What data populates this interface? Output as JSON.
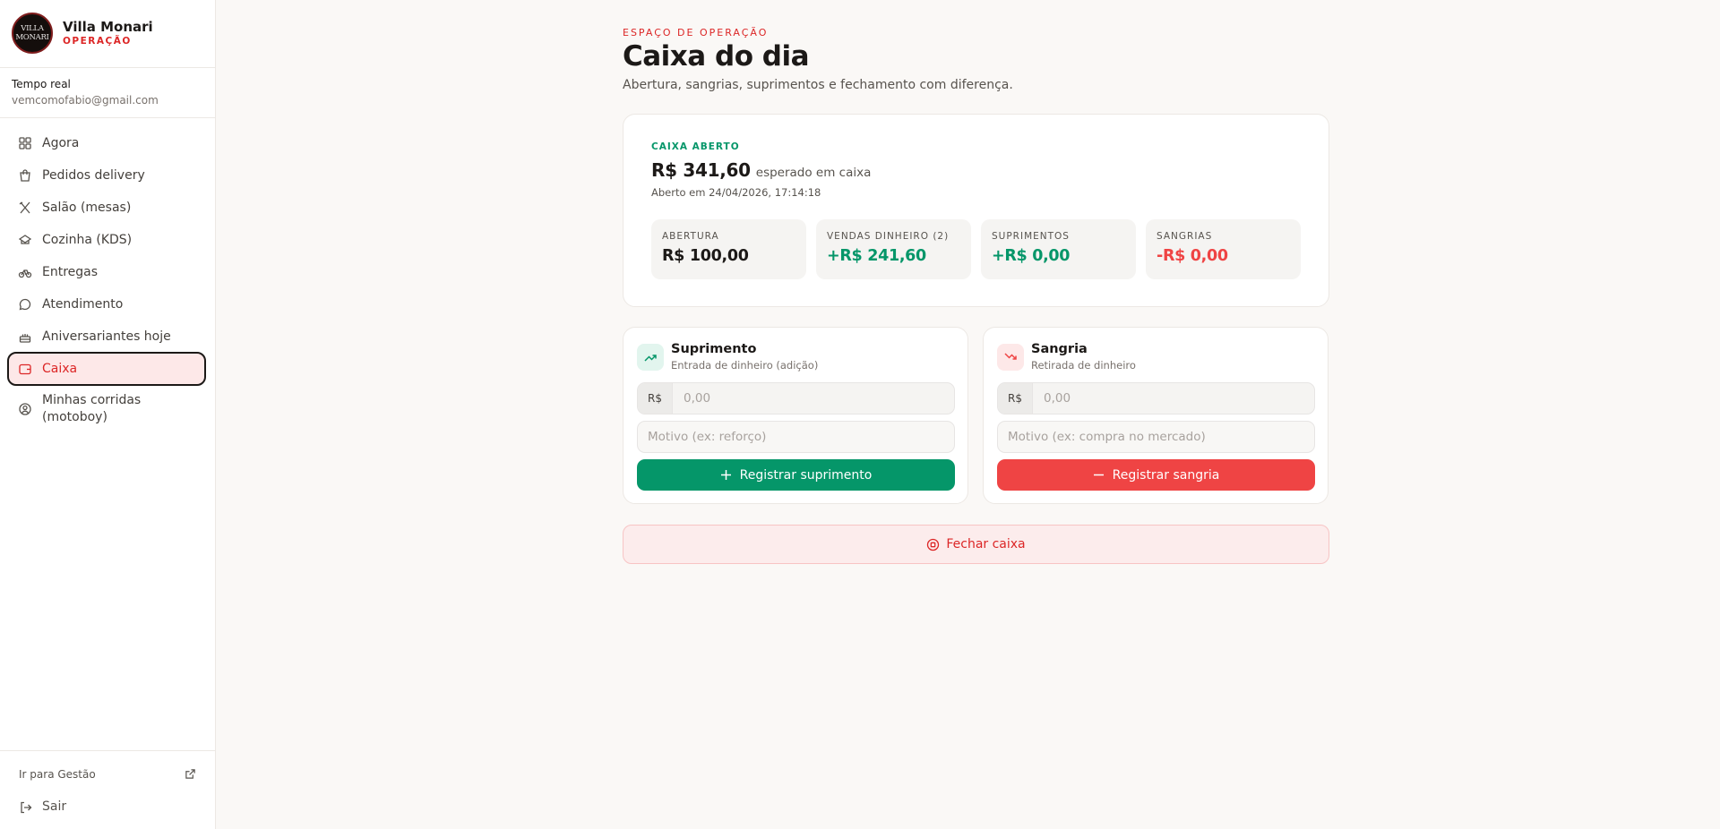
{
  "brand": {
    "logo_text_1": "VILLA",
    "logo_text_2": "MONARI",
    "name": "Villa Monari",
    "subtitle": "OPERAÇÃO"
  },
  "user": {
    "label": "Tempo real",
    "email": "vemcomofabio@gmail.com"
  },
  "nav": {
    "items": [
      {
        "label": "Agora",
        "icon": "grid-icon"
      },
      {
        "label": "Pedidos delivery",
        "icon": "shopping-bag-icon"
      },
      {
        "label": "Salão (mesas)",
        "icon": "utensils-icon"
      },
      {
        "label": "Cozinha (KDS)",
        "icon": "chef-hat-icon"
      },
      {
        "label": "Entregas",
        "icon": "bike-icon"
      },
      {
        "label": "Atendimento",
        "icon": "chat-bubble-icon"
      },
      {
        "label": "Aniversariantes hoje",
        "icon": "cake-icon"
      },
      {
        "label": "Caixa",
        "icon": "wallet-icon",
        "active": true
      },
      {
        "label": "Minhas corridas (motoboy)",
        "icon": "user-circle-icon"
      }
    ],
    "gestao_label": "Ir para Gestão",
    "sair_label": "Sair"
  },
  "header": {
    "eyebrow": "ESPAÇO DE OPERAÇÃO",
    "title": "Caixa do dia",
    "subtitle": "Abertura, sangrias, suprimentos e fechamento com diferença."
  },
  "status": {
    "label": "CAIXA ABERTO",
    "expected_amount": "R$ 341,60",
    "expected_text": "esperado em caixa",
    "opened_at": "Aberto em 24/04/2026, 17:14:18",
    "stats": [
      {
        "key": "ABERTURA",
        "value": "R$ 100,00",
        "tone": "dark"
      },
      {
        "key": "VENDAS DINHEIRO (2)",
        "value": "+R$ 241,60",
        "tone": "green"
      },
      {
        "key": "SUPRIMENTOS",
        "value": "+R$ 0,00",
        "tone": "green"
      },
      {
        "key": "SANGRIAS",
        "value": "-R$ 0,00",
        "tone": "red"
      }
    ]
  },
  "suprimento": {
    "title": "Suprimento",
    "subtitle": "Entrada de dinheiro (adição)",
    "currency": "R$",
    "amount_value": "",
    "amount_placeholder": "0,00",
    "reason_value": "",
    "reason_placeholder": "Motivo (ex: reforço)",
    "button_label": "Registrar suprimento"
  },
  "sangria": {
    "title": "Sangria",
    "subtitle": "Retirada de dinheiro",
    "currency": "R$",
    "amount_value": "",
    "amount_placeholder": "0,00",
    "reason_value": "",
    "reason_placeholder": "Motivo (ex: compra no mercado)",
    "button_label": "Registrar sangria"
  },
  "close": {
    "label": "Fechar caixa"
  },
  "colors": {
    "accent_red": "#dc2626",
    "accent_green": "#059669",
    "danger": "#ef4444",
    "active_bg": "#fde8e8"
  }
}
